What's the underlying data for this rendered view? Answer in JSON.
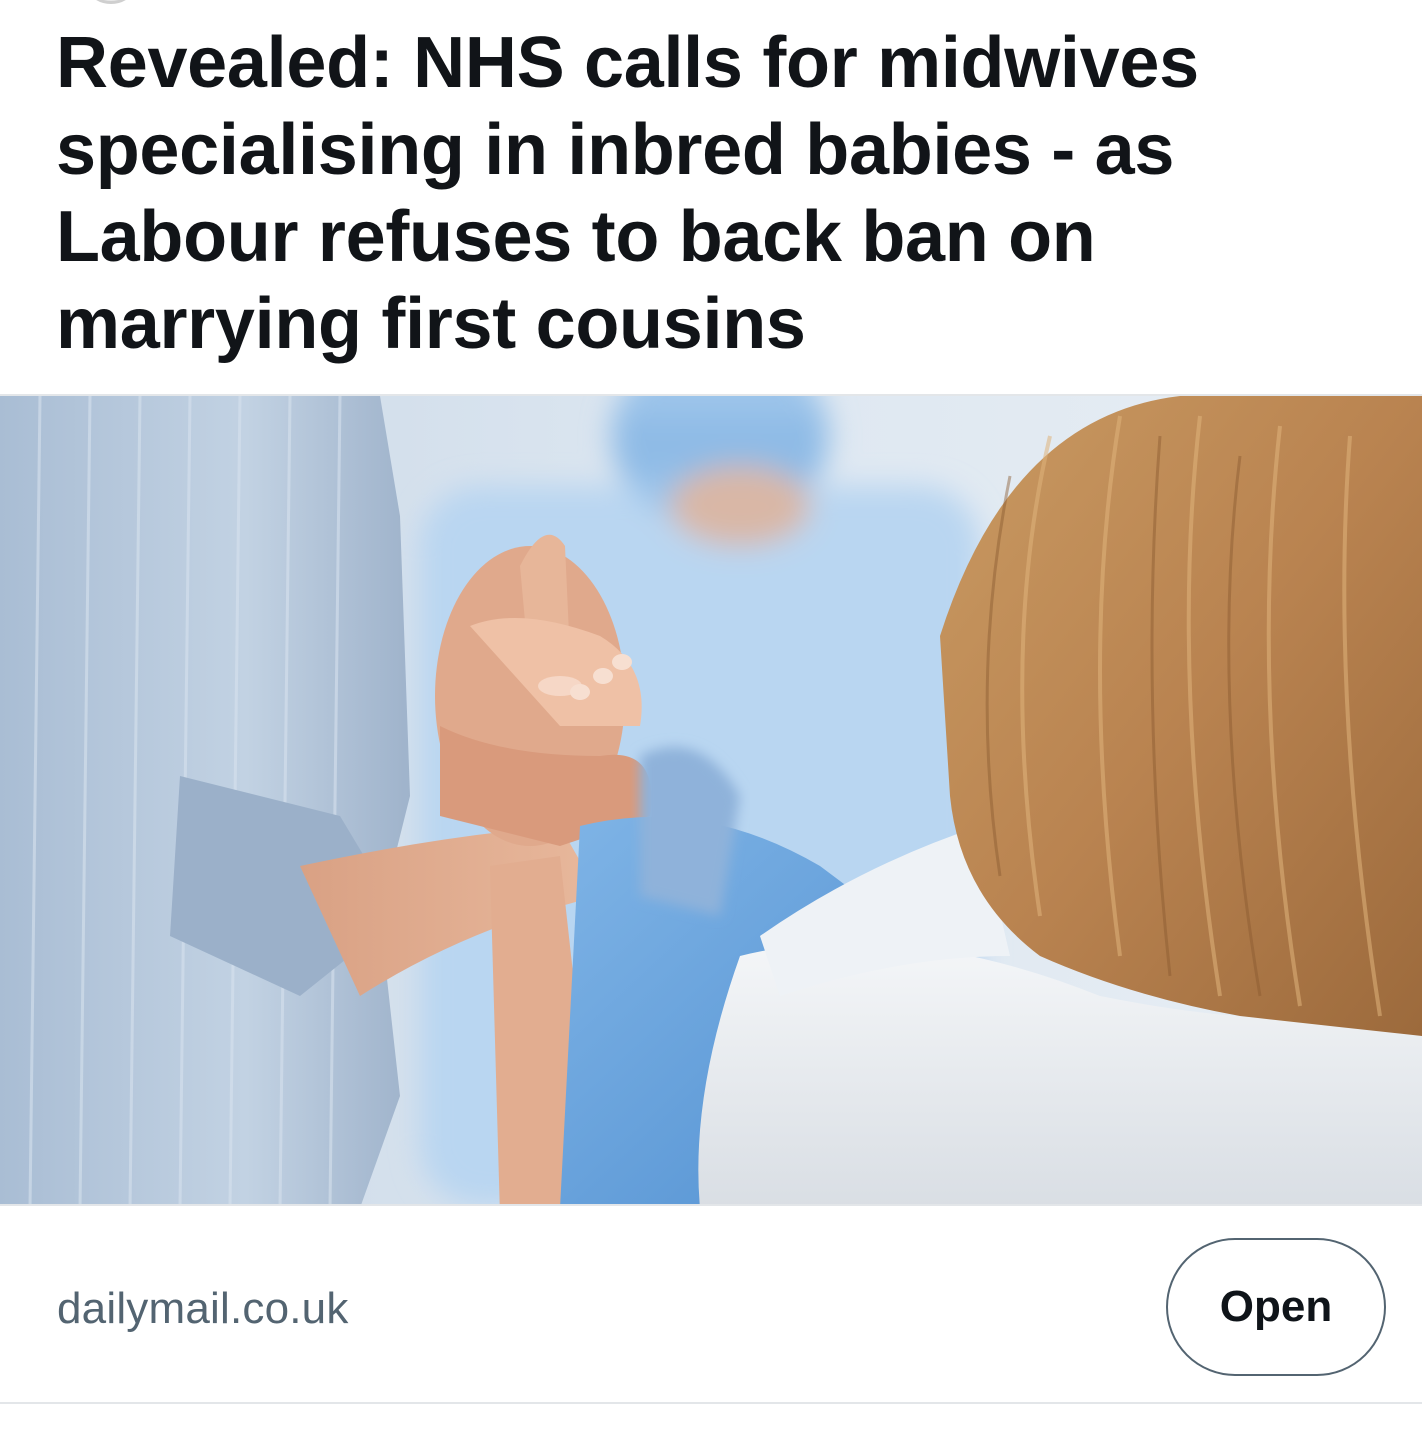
{
  "post": {
    "headline": "Revealed: NHS calls for midwives specialising in inbred babies - as Labour refuses to back ban on marrying first cousins",
    "image_icon": "photo-hospital-birth",
    "source_domain": "dailymail.co.uk",
    "open_label": "Open"
  },
  "colors": {
    "headline_text": "#111418",
    "source_text": "#536471",
    "button_border": "#536471",
    "divider": "#e3e6e9"
  }
}
